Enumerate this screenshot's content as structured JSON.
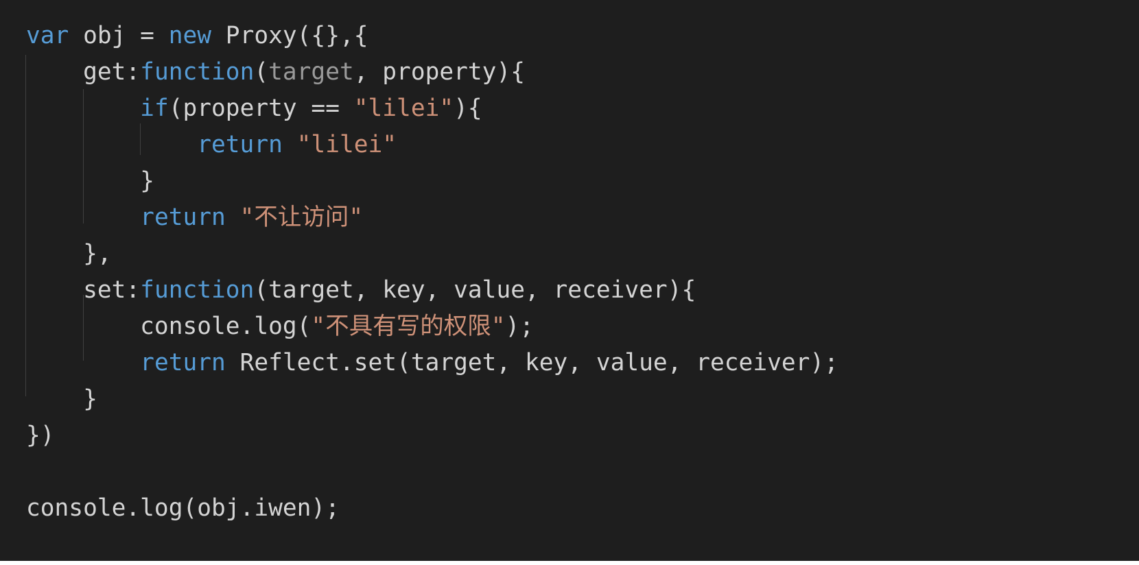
{
  "editor": {
    "theme": {
      "background": "#1e1e1e",
      "keyword": "#569cd6",
      "string": "#ce9178",
      "text": "#d4d4d4",
      "dimmed": "#9a9a9a",
      "indent_guide": "#404040"
    },
    "lines": [
      {
        "tokens": [
          {
            "t": "var",
            "c": "kw"
          },
          {
            "t": " obj = ",
            "c": "plain"
          },
          {
            "t": "new",
            "c": "kw"
          },
          {
            "t": " Proxy({},{",
            "c": "plain"
          }
        ]
      },
      {
        "tokens": [
          {
            "t": "    get:",
            "c": "plain"
          },
          {
            "t": "function",
            "c": "kw"
          },
          {
            "t": "(",
            "c": "plain"
          },
          {
            "t": "target",
            "c": "dim"
          },
          {
            "t": ", property){",
            "c": "plain"
          }
        ]
      },
      {
        "tokens": [
          {
            "t": "        ",
            "c": "plain"
          },
          {
            "t": "if",
            "c": "kw"
          },
          {
            "t": "(property == ",
            "c": "plain"
          },
          {
            "t": "\"lilei\"",
            "c": "str"
          },
          {
            "t": "){",
            "c": "plain"
          }
        ]
      },
      {
        "tokens": [
          {
            "t": "            ",
            "c": "plain"
          },
          {
            "t": "return",
            "c": "kw"
          },
          {
            "t": " ",
            "c": "plain"
          },
          {
            "t": "\"lilei\"",
            "c": "str"
          }
        ]
      },
      {
        "tokens": [
          {
            "t": "        }",
            "c": "plain"
          }
        ]
      },
      {
        "tokens": [
          {
            "t": "        ",
            "c": "plain"
          },
          {
            "t": "return",
            "c": "kw"
          },
          {
            "t": " ",
            "c": "plain"
          },
          {
            "t": "\"不让访问\"",
            "c": "str"
          }
        ]
      },
      {
        "tokens": [
          {
            "t": "    },",
            "c": "plain"
          }
        ]
      },
      {
        "tokens": [
          {
            "t": "    set:",
            "c": "plain"
          },
          {
            "t": "function",
            "c": "kw"
          },
          {
            "t": "(target, key, value, receiver){",
            "c": "plain"
          }
        ]
      },
      {
        "tokens": [
          {
            "t": "        console.log(",
            "c": "plain"
          },
          {
            "t": "\"不具有写的权限\"",
            "c": "str"
          },
          {
            "t": ");",
            "c": "plain"
          }
        ]
      },
      {
        "tokens": [
          {
            "t": "        ",
            "c": "plain"
          },
          {
            "t": "return",
            "c": "kw"
          },
          {
            "t": " Reflect.set(target, key, value, receiver);",
            "c": "plain"
          }
        ]
      },
      {
        "tokens": [
          {
            "t": "    }",
            "c": "plain"
          }
        ]
      },
      {
        "tokens": [
          {
            "t": "})",
            "c": "plain"
          }
        ]
      },
      {
        "tokens": []
      },
      {
        "tokens": [
          {
            "t": "console.log(obj.iwen);",
            "c": "plain"
          }
        ]
      }
    ]
  }
}
